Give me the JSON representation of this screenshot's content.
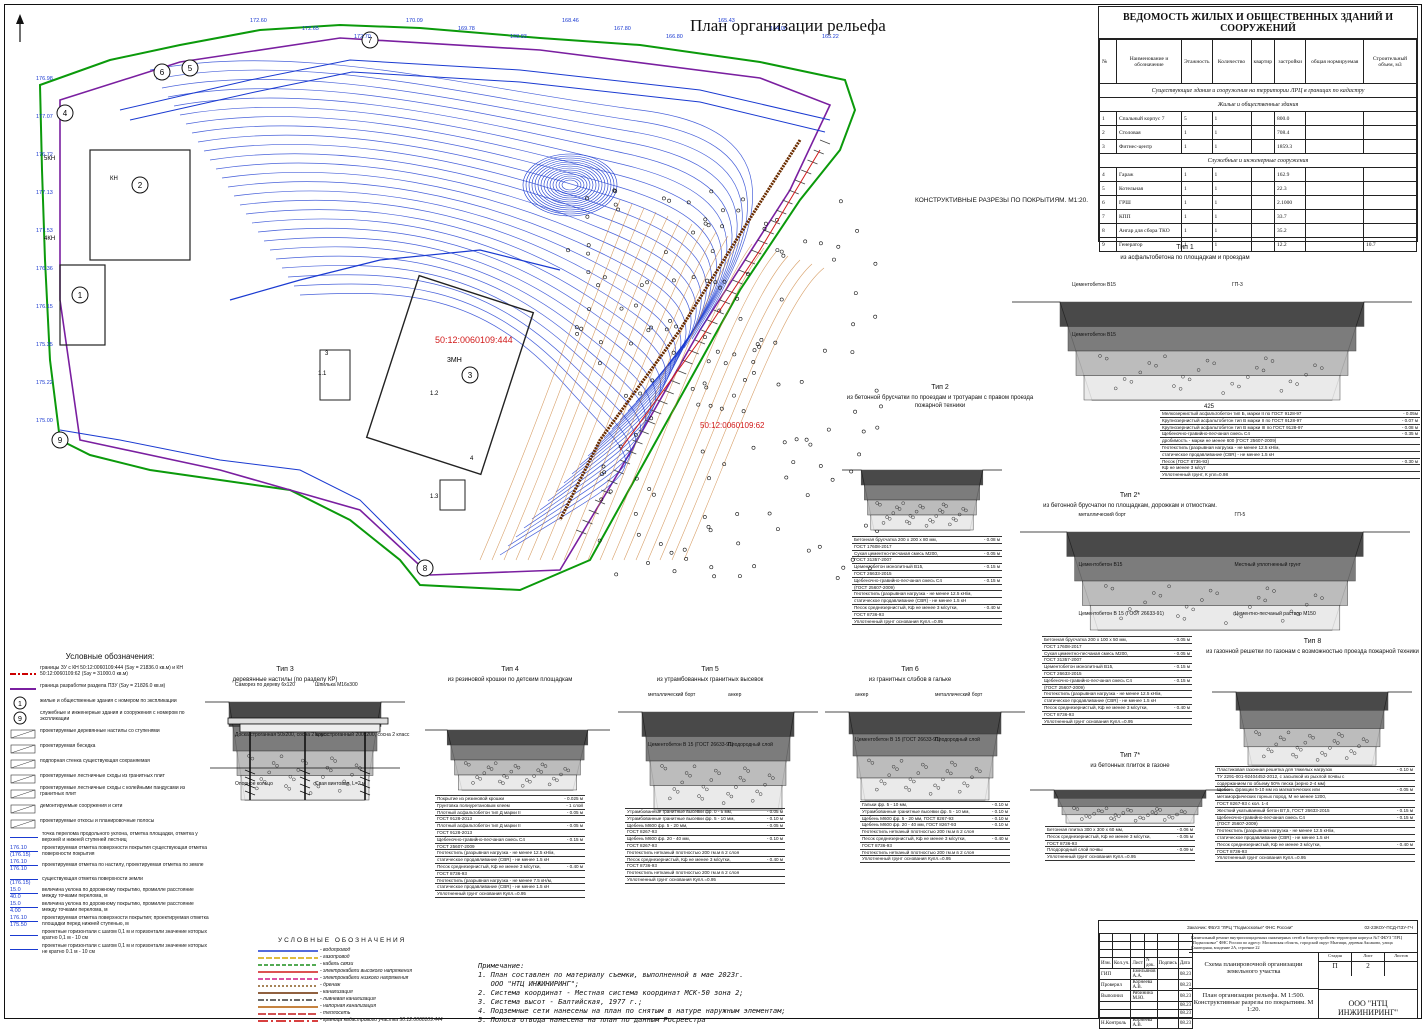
{
  "plan": {
    "title": "План организации рельефа",
    "parcel_main": "50:12:0060109:444",
    "parcel_secondary": "50:12:0060109:62",
    "building_3_code": "3МН",
    "sections_title": "КОНСТРУКТИВНЫЕ РАЗРЕЗЫ ПО ПОКРЫТИЯМ. М1:20.",
    "top_labels": [
      "172.60",
      "172.65",
      "172.70",
      "170.09",
      "169.78",
      "168.83",
      "168.46",
      "167.80",
      "166.80",
      "165.43",
      "164.06",
      "165.22"
    ],
    "left_labels": [
      "176.98",
      "177.07",
      "176.72",
      "177.13",
      "177.53",
      "176.36",
      "176.15",
      "175.35",
      "175.22",
      "175.00"
    ],
    "building_numbers": [
      "1",
      "2",
      "3",
      "4",
      "5",
      "6",
      "7",
      "8",
      "9"
    ],
    "section_marks": [
      "1.1",
      "1.2",
      "1.3",
      "3",
      "4",
      "5КН",
      "КН",
      "4КН"
    ]
  },
  "buildings_table": {
    "title": "ВЕДОМОСТЬ ЖИЛЫХ И ОБЩЕСТВЕННЫХ ЗДАНИЙ И СООРУЖЕНИЙ",
    "headers": {
      "num": "№",
      "name": "Наименование и обозначение",
      "floors": "Этажность",
      "count": "Количество",
      "count_buildings": "зданий",
      "count_apts": "квартир",
      "area": "Площадь, м2",
      "area_built": "застройки",
      "area_total": "общая нормируемая",
      "volume": "Строительный объем, м3",
      "building": "здания",
      "all": "всего"
    },
    "section1": "Существующие здания и сооружения на территории ЛРЦ в границах по кадастру",
    "section1a": "Жилые и общественные здания",
    "rows1": [
      {
        "n": "1",
        "name": "Спальный корпус 7",
        "floors": "5",
        "count": "1",
        "area": "800.0"
      },
      {
        "n": "2",
        "name": "Столовая",
        "floors": "1",
        "count": "1",
        "area": "708.4"
      },
      {
        "n": "3",
        "name": "Фитнес-центр",
        "floors": "1",
        "count": "1",
        "area": "1859.3"
      }
    ],
    "section2": "Служебные и инженерные сооружения",
    "rows2": [
      {
        "n": "4",
        "name": "Гараж",
        "floors": "1",
        "count": "1",
        "area": "162.9",
        "extra": ""
      },
      {
        "n": "5",
        "name": "Котельная",
        "floors": "1",
        "count": "1",
        "area": "22.3",
        "extra": ""
      },
      {
        "n": "6",
        "name": "ГРШ",
        "floors": "1",
        "count": "1",
        "area": "2.1000",
        "extra": ""
      },
      {
        "n": "7",
        "name": "КПП",
        "floors": "1",
        "count": "1",
        "area": "33.7",
        "extra": ""
      },
      {
        "n": "8",
        "name": "Ангар для сбора ТКО",
        "floors": "1",
        "count": "1",
        "area": "35.2",
        "extra": ""
      },
      {
        "n": "9",
        "name": "Генератор",
        "floors": "1",
        "count": "1",
        "area": "12.2",
        "extra": "10.7"
      }
    ]
  },
  "types": {
    "t1": {
      "title": "Тип 1",
      "subtitle": "из асфальтобетона по площадкам и проездам",
      "labels": [
        "Цементобетон В15",
        "ГП-3",
        "Цементобетон В15"
      ],
      "dim": "425",
      "layers": [
        [
          "Мелкозернистый асфальтобетон тип Б, марки II по ГОСТ 9128-97",
          "- 0.05м"
        ],
        [
          "Крупнозернистый асфальтобетон тип В марки II по ГОСТ 9128-97",
          "- 0.07 м"
        ],
        [
          "Крупнозернистый асфальтобетон тип В марки III по ГОСТ 9128-97",
          "- 0.08 м"
        ],
        [
          "Щебеночно-гравийно-песчаная смесь С4",
          "- 0.35 м"
        ],
        [
          "дробимость - марки не менее 600 (ГОСТ 25607-2009)",
          ""
        ],
        [
          "Геотекстиль (разрывная нагрузка - не менее 12.5 кН/м,",
          ""
        ],
        [
          "статическое продавливание (CBR) - не менее 1.5 кН",
          ""
        ],
        [
          "Песок (ГОСТ 8736-93)",
          "- 0.30 м"
        ],
        [
          "Кф не менее 3 м/сут",
          ""
        ],
        [
          "Уплотненный грунт, К упл=0.98",
          ""
        ]
      ]
    },
    "t2": {
      "title": "Тип 2",
      "subtitle": "из бетонной брусчатки по проездам и тротуарам с правом проезда пожарной техники",
      "layers": [
        [
          "Бетонная брусчатка 200 х 200 х 80 мм,",
          "- 0.08 м"
        ],
        [
          "ГОСТ 17608-2017",
          ""
        ],
        [
          "Сухая цементно-песчаная смесь М200,",
          "- 0.05 м"
        ],
        [
          "ГОСТ 31357-2007",
          ""
        ],
        [
          "Цементобетон монолитный В15,",
          "- 0.15 м"
        ],
        [
          "ГОСТ 26633-2015",
          ""
        ],
        [
          "Щебеночно-гравийно-песчаная смесь С4",
          "- 0.15 м"
        ],
        [
          "(ГОСТ 25607-2009)",
          ""
        ],
        [
          "Геотекстиль (разрывная нагрузка - не менее 12.5 кН/м,",
          ""
        ],
        [
          "статическое продавливание (CBR) - не менее 1.5 кН",
          ""
        ],
        [
          "Песок среднезернистый, Кф не менее 3 м/сутки,",
          "- 0.40 м"
        ],
        [
          "ГОСТ 8736-93",
          ""
        ],
        [
          "Уплотненный грунт основания Купл.=0.95",
          ""
        ]
      ]
    },
    "t2s": {
      "title": "Тип 2*",
      "subtitle": "из бетонной брусчатки по площадкам, дорожкам и отмосткам.",
      "labels": [
        "металлический борт",
        "ГП-5",
        "Цементобетон В15",
        "Местный уплотненный грунт",
        "Цементобетон В 15 (ГОСТ 26633-91)",
        "Цементно-песчаный раствор М150"
      ],
      "layers": [
        [
          "Бетонная брусчатка 200 х 100 х 50 мм,",
          "- 0.05 м"
        ],
        [
          "ГОСТ 17608-2017",
          ""
        ],
        [
          "Сухая цементно-песчаная смесь М200,",
          "- 0.05 м"
        ],
        [
          "ГОСТ 31357-2007",
          ""
        ],
        [
          "Цементобетон монолитный В15,",
          "- 0.15 м"
        ],
        [
          "ГОСТ 26633-2015",
          ""
        ],
        [
          "Щебеночно-гравийно-песчаная смесь С4",
          "- 0.15 м"
        ],
        [
          "(ГОСТ 25607-2009)",
          ""
        ],
        [
          "Геотекстиль (разрывная нагрузка - не менее 12.5 кН/м,",
          ""
        ],
        [
          "статическое продавливание (CBR) - не менее 1.5 кН",
          ""
        ],
        [
          "Песок среднезернистый, Кф не менее 3 м/сутки,",
          "- 0.40 м"
        ],
        [
          "ГОСТ 8736-93",
          ""
        ],
        [
          "Уплотненный грунт основания Купл.=0.95",
          ""
        ]
      ]
    },
    "t3": {
      "title": "Тип 3",
      "subtitle": "деревянные настилы (по разделу КР)",
      "labels": [
        "Саморез по дереву 6х120",
        "Шпилька М16х300",
        "Доска строганная 50х200, сосна 2 класс",
        "Брус строганный 200х200, сосна 2 класс",
        "Опорное кольцо",
        "Свая винтовая, L=2 м"
      ]
    },
    "t4": {
      "title": "Тип 4",
      "subtitle": "из резиновой крошки по детским площадкам",
      "layers": [
        [
          "Покрытие из резиновой крошки",
          "- 0.025 м"
        ],
        [
          "Грунтовка полиуретановым клеем",
          "- 1 слой"
        ],
        [
          "Плотный асфальтобетон тип Д марки II",
          "- 0.05 м"
        ],
        [
          "ГОСТ 9128-2013",
          ""
        ],
        [
          "Плотный асфальтобетон тип Д марки II",
          "- 0.05 м"
        ],
        [
          "ГОСТ 9128-2013",
          ""
        ],
        [
          "Щебеночно-гравийно-песчаная смесь С4",
          "- 0.15 м"
        ],
        [
          "ГОСТ 25607-2009",
          ""
        ],
        [
          "Геотекстиль (разрывная нагрузка - не менее 12.5 кН/м,",
          ""
        ],
        [
          "статическое продавливание (CBR) - не менее 1.5 кН",
          ""
        ],
        [
          "Песок среднезернистый, Кф не менее 3 м/сутки,",
          "- 0.40 м"
        ],
        [
          "ГОСТ 8736-93",
          ""
        ],
        [
          "Геотекстиль (разрывная нагрузка - не менее 7.5 кН/м,",
          ""
        ],
        [
          "статическое продавливание (CBR) - не менее 1.5 кН",
          ""
        ],
        [
          "Уплотненный грунт основания Купл.=0.95",
          ""
        ]
      ]
    },
    "t5": {
      "title": "Тип 5",
      "subtitle": "из утрамбованных гранитных высевок",
      "labels": [
        "металлический борт",
        "анкер",
        "Цементобетон В 15 (ГОСТ 26633-91)",
        "Плодородный слой"
      ],
      "layers": [
        [
          "Утрамбованные гранитные высевки фр. 0 - 5 мм,",
          "- 0.05 м"
        ],
        [
          "Утрамбованные гранитные высевки фр. 5 - 10 мм,",
          "- 0.10 м"
        ],
        [
          "Щебень М600 фр. 5 - 20 мм,",
          "- 0.05 м"
        ],
        [
          "ГОСТ 8267-93",
          ""
        ],
        [
          "Щебень М600 фр. 20 - 40 мм,",
          "- 0.10 м"
        ],
        [
          "ГОСТ 8267-93",
          ""
        ],
        [
          "Геотекстиль нетканый плотностью 200 гм.м в 2 слоя",
          ""
        ],
        [
          "Песок среднезернистый, Кф не менее 3 м/сутки,",
          "- 0.40 м"
        ],
        [
          "ГОСТ 8736-93",
          ""
        ],
        [
          "Геотекстиль нетканый плотностью 200 гм.м в 2 слоя",
          ""
        ],
        [
          "Уплотненный грунт основания Купл.=0.95",
          ""
        ]
      ]
    },
    "t6": {
      "title": "Тип 6",
      "subtitle": "из гранитных слэбов в гальке",
      "labels": [
        "анкер",
        "металлический борт",
        "Цементобетон В 15 (ГОСТ 26633-91)",
        "Плодородный слой"
      ],
      "layers": [
        [
          "Гальки фр. 5 - 10 мм,",
          "- 0.10 м"
        ],
        [
          "Утрамбованные гранитные высевки фр. 5 - 10 мм,",
          "- 0.10 м"
        ],
        [
          "Щебень М600 фр. 5 - 20 мм, ГОСТ 8267-93",
          "- 0.10 м"
        ],
        [
          "Щебень М600 фр. 20 - 40 мм, ГОСТ 8267-93",
          "- 0.10 м"
        ],
        [
          "Геотекстиль нетканый плотностью 200 гм.м в 2 слоя",
          ""
        ],
        [
          "Песок среднезернистый, Кф не менее 3 м/сутки,",
          "- 0.40 м"
        ],
        [
          "ГОСТ 8736-93",
          ""
        ],
        [
          "Геотекстиль нетканый плотностью 200 гм.м в 2 слоя",
          ""
        ],
        [
          "Уплотненный грунт основания Купл.=0.95",
          ""
        ]
      ]
    },
    "t7": {
      "title": "Тип 7*",
      "subtitle": "из бетонных плиток в газоне",
      "layers": [
        [
          "Бетонная плитка 300 х 300 х 60 мм,",
          "- 0.06 м"
        ],
        [
          "Песок среднезернистый, Кф не менее 3 м/сутки,",
          "- 0.05 м"
        ],
        [
          "ГОСТ 8736-93",
          ""
        ],
        [
          "Плодородный слой почвы",
          "- 0.09 м"
        ],
        [
          "Уплотненный грунт основания Купл.=0.95",
          ""
        ]
      ]
    },
    "t8": {
      "title": "Тип 8",
      "subtitle": "из газонной решетки по газонам с возможностью проезда пожарной техники",
      "layers": [
        [
          "Пластиковая газонная решетка для тяжелых нагрузок",
          "- 0.10 м"
        ],
        [
          "ТУ 2291-001-92404452-2012, с засыпкой из рыхлой почвы с",
          ""
        ],
        [
          "содержанием по объему 50% песка (зерно 2-4 мм)",
          ""
        ],
        [
          "Щебень фракции 5-10 мм из магматических или",
          "- 0.05 м"
        ],
        [
          "метаморфических горных пород, М не менее 1200,",
          ""
        ],
        [
          "ГОСТ 8267-93 с кол. 1-4",
          ""
        ],
        [
          "Жесткий укатываемый бетон В7,5, ГОСТ 26633-2015",
          "- 0.15 м"
        ],
        [
          "Щебеночно-гравийно-песчаная смесь С4",
          "- 0.15 м"
        ],
        [
          "(ГОСТ 25607-2009)",
          ""
        ],
        [
          "Геотекстиль (разрывная нагрузка - не менее 12.5 кН/м,",
          ""
        ],
        [
          "статическое продавливание (CBR) - не менее 1.5 кН",
          ""
        ],
        [
          "Песок среднезернистый, Кф не менее 3 м/сутки,",
          "- 0.40 м"
        ],
        [
          "ГОСТ 8736-93",
          ""
        ],
        [
          "Уплотненный грунт основания Купл.=0.95",
          ""
        ]
      ]
    }
  },
  "legend": {
    "title": "Условные обозначения:",
    "items": [
      "границы ЗУ с КН 50:12:0060109:444 (Sзу = 21836.0 кв.м) и КН 50:12:0060109:62 (Sзу = 31000.0 кв.м)",
      "граница разработки раздела ПЗУ (Sзу = 21826.0 кв.м)",
      "жилые и общественные здания с номером по экспликации",
      "служебные и инженерные здания и сооружения с номером по экспликации",
      "проектируемые деревянные настилы со ступенями",
      "проектируемая беседка",
      "подпорная стенка существующая сохраняемая",
      "проектируемые лестничные сходы из гранитных плит",
      "проектируемые лестничные сходы с колейными пандусами из гранитных плит",
      "демонтируемые сооружения и сети",
      "проектируемые откосы и планировочные полосы"
    ],
    "marks": [
      {
        "top": "",
        "bot": "",
        "text": "точка перелома продольного уклона, отметка площадки, отметка у верхней и нижней ступеней лестниц"
      },
      {
        "top": "176.10",
        "bot": "(176.15)",
        "text": "проектируемая отметка поверхности покрытия существующая отметка поверхности покрытия"
      },
      {
        "top": "176.10",
        "bot": "176.10",
        "text": "проектируемая отметка по настилу, проектируемая отметка по земле"
      },
      {
        "top": "",
        "bot": "(176.15)",
        "text": "существующая отметка поверхности земли"
      },
      {
        "top": "15.0",
        "bot": "40.0",
        "text": "величина уклона по дорожному покрытию, промилле расстояние между точками перелома, м"
      },
      {
        "top": "15.0",
        "bot": "4.00",
        "text": "величина уклона по дорожному покрытию, промилле расстояние между точками перелома, м"
      },
      {
        "top": "176.10",
        "bot": "175.50",
        "text": "проектируемая отметка поверхности покрытия; проектируемая отметка площадки перед нижней ступенью, м"
      },
      {
        "top": "",
        "bot": "",
        "text": "проектные горизонтали с шагом 0,1 м и горизонтали значение которых кратно 0,1 м - 10 см"
      },
      {
        "top": "",
        "bot": "",
        "text": "проектные горизонтали с шагом 0,1 м и горизонтали значение которых не кратно 0.1 м - 10 см"
      }
    ]
  },
  "utility_legend": {
    "title": "УСЛОВНЫЕ ОБОЗНАЧЕНИЯ",
    "items": [
      {
        "label": "- водопровод",
        "color": "#1a3ad1",
        "dash": ""
      },
      {
        "label": "- газопровод",
        "color": "#d4a500",
        "dash": "6 2"
      },
      {
        "label": "- кабель связи",
        "color": "#1b8f1b",
        "dash": "4 2"
      },
      {
        "label": "- электрокабели высокого напряжения",
        "color": "#d11a1a",
        "dash": ""
      },
      {
        "label": "- электрокабели низкого напряжения",
        "color": "#d11a8a",
        "dash": "5 2"
      },
      {
        "label": "- дренаж",
        "color": "#8a5a20",
        "dash": "2 2"
      },
      {
        "label": "- канализация",
        "color": "#6b2d00",
        "dash": ""
      },
      {
        "label": "- ливневая канализация",
        "color": "#3a3a3a",
        "dash": "6 2 2 2"
      },
      {
        "label": "- напорная канализация",
        "color": "#b35a00",
        "dash": ""
      },
      {
        "label": "- теплосеть",
        "color": "#c21818",
        "dash": "8 2"
      },
      {
        "label": "- граница кадастрового участка 50:12:0060109:444",
        "color": "#cc0000",
        "dash": "10 3 2 3"
      }
    ]
  },
  "notes": {
    "title": "Примечание:",
    "items": [
      "1. План составлен по материалу съемки, выполненной в мае 2023г.",
      "   ООО \"НТЦ ИНЖИНИРИНГ\";",
      "2. Система координат - Местная система координат МСК-50 зона 2;",
      "3. Система высот - Балтийская, 1977 г.;",
      "4. Подземные сети нанесены на план по снятым в натуре наружным элементам;",
      "5. Полоса отвода нанесена на план по данным Росреестра"
    ]
  },
  "title_block": {
    "customer": "Заказчик: ФБУЗ \"ЛРЦ \"Подмосковье\" ФНС России\"",
    "code": "02-23КОУ-ПСД-ПЗУ-ГЧ",
    "project": "Капитальный ремонт внутриплощадочных инженерных сетей и благоустройство территории корпуса №7 ФБУЗ \"ЛРЦ \"Подмосковье\" ФНС России по адресу: Московская область, городской округ Мытищи, деревня Аксаково, улица Санаторная, владение 2А, строение 22",
    "sheet_name": "Схема планировочной организации земельного участка",
    "drawing": "План организации рельефа. М 1:500. Конструктивные разрезы по покрытиям. М 1:20.",
    "company": "ООО \"НТЦ ИНЖИНИРИНГ\"",
    "stage_h": "Стадия",
    "sheet_h": "Лист",
    "sheets_h": "Листов",
    "stage": "П",
    "sheet": "2",
    "cols": [
      "Изм.",
      "Кол.уч.",
      "Лист",
      "N док.",
      "Подпись",
      "Дата"
    ],
    "people": [
      {
        "role": "ГИП",
        "name": "Емельянов А.А.",
        "date": "08.23"
      },
      {
        "role": "Проверил",
        "name": "Корнеева А.В.",
        "date": "08.23"
      },
      {
        "role": "Выполнил",
        "name": "Рябинина М.Ю.",
        "date": "08.23"
      },
      {
        "role": "",
        "name": "",
        "date": "08.23"
      },
      {
        "role": "",
        "name": "",
        "date": "08.23"
      },
      {
        "role": "Н.Контроль",
        "name": "Корнеева А.В.",
        "date": "08.23"
      }
    ]
  }
}
